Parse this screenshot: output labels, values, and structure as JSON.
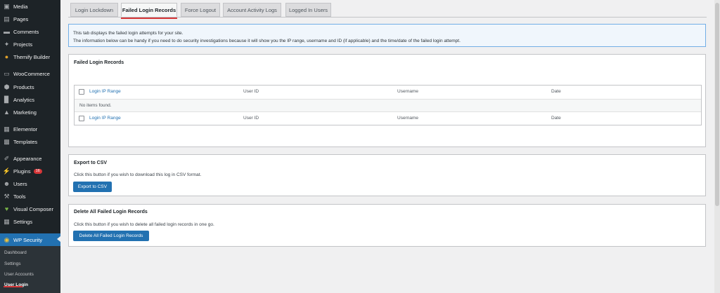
{
  "sidebar": {
    "items": [
      {
        "label": "Media",
        "icon": "media-icon"
      },
      {
        "label": "Pages",
        "icon": "pages-icon"
      },
      {
        "label": "Comments",
        "icon": "comments-icon"
      },
      {
        "label": "Projects",
        "icon": "projects-icon"
      },
      {
        "label": "Themify Builder",
        "icon": "themify-icon"
      },
      {
        "label": "WooCommerce",
        "icon": "woocommerce-icon"
      },
      {
        "label": "Products",
        "icon": "products-icon"
      },
      {
        "label": "Analytics",
        "icon": "analytics-icon"
      },
      {
        "label": "Marketing",
        "icon": "marketing-icon"
      },
      {
        "label": "Elementor",
        "icon": "elementor-icon"
      },
      {
        "label": "Templates",
        "icon": "templates-icon"
      },
      {
        "label": "Appearance",
        "icon": "appearance-icon"
      },
      {
        "label": "Plugins",
        "icon": "plugins-icon",
        "badge": "16"
      },
      {
        "label": "Users",
        "icon": "users-icon"
      },
      {
        "label": "Tools",
        "icon": "tools-icon"
      },
      {
        "label": "Visual Composer",
        "icon": "visual-composer-icon"
      },
      {
        "label": "Settings",
        "icon": "settings-icon"
      },
      {
        "label": "WP Security",
        "icon": "wp-security-icon",
        "active": true
      }
    ],
    "submenu": [
      {
        "label": "Dashboard"
      },
      {
        "label": "Settings"
      },
      {
        "label": "User Accounts"
      },
      {
        "label": "User Login",
        "current": true
      }
    ]
  },
  "tabs": [
    {
      "label": "Login Lockdown"
    },
    {
      "label": "Failed Login Records",
      "active": true
    },
    {
      "label": "Force Logout"
    },
    {
      "label": "Account Activity Logs"
    },
    {
      "label": "Logged In Users"
    }
  ],
  "info": {
    "line1": "This tab displays the failed login attempts for your site.",
    "line2": "The information below can be handy if you need to do security investigations because it will show you the IP range, username and ID (if applicable) and the time/date of the failed login attempt."
  },
  "records": {
    "title": "Failed Login Records",
    "columns": [
      "Login IP Range",
      "User ID",
      "Username",
      "Date"
    ],
    "empty_message": "No items found."
  },
  "export": {
    "title": "Export to CSV",
    "description": "Click this button if you wish to download this log in CSV format.",
    "button": "Export to CSV"
  },
  "delete": {
    "title": "Delete All Failed Login Records",
    "description": "Click this button if you wish to delete all failed login records in one go.",
    "button": "Delete All Failed Login Records"
  },
  "colors": {
    "sidebar_bg": "#1d2327",
    "accent": "#2271b1",
    "underline": "#d63638"
  }
}
